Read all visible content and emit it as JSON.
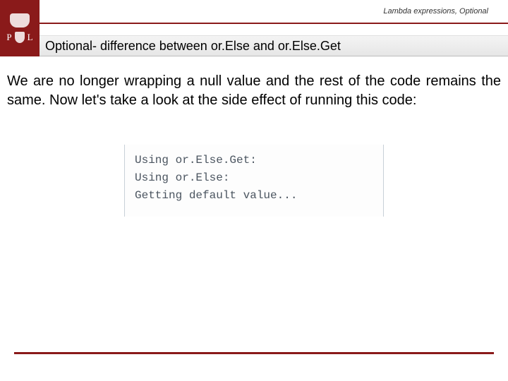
{
  "header": {
    "breadcrumb": "Lambda expressions, Optional",
    "logo_left_letter": "P",
    "logo_right_letter": "L",
    "title": "Optional- difference between or.Else and or.Else.Get"
  },
  "body": {
    "paragraph": "We are no longer wrapping a null value and the rest of the code remains the same. Now let's take a look at the side effect of running this code:"
  },
  "code": {
    "lines": "Using or.Else.Get:\nUsing or.Else:\nGetting default value..."
  },
  "colors": {
    "brand": "#8a1a1a"
  }
}
